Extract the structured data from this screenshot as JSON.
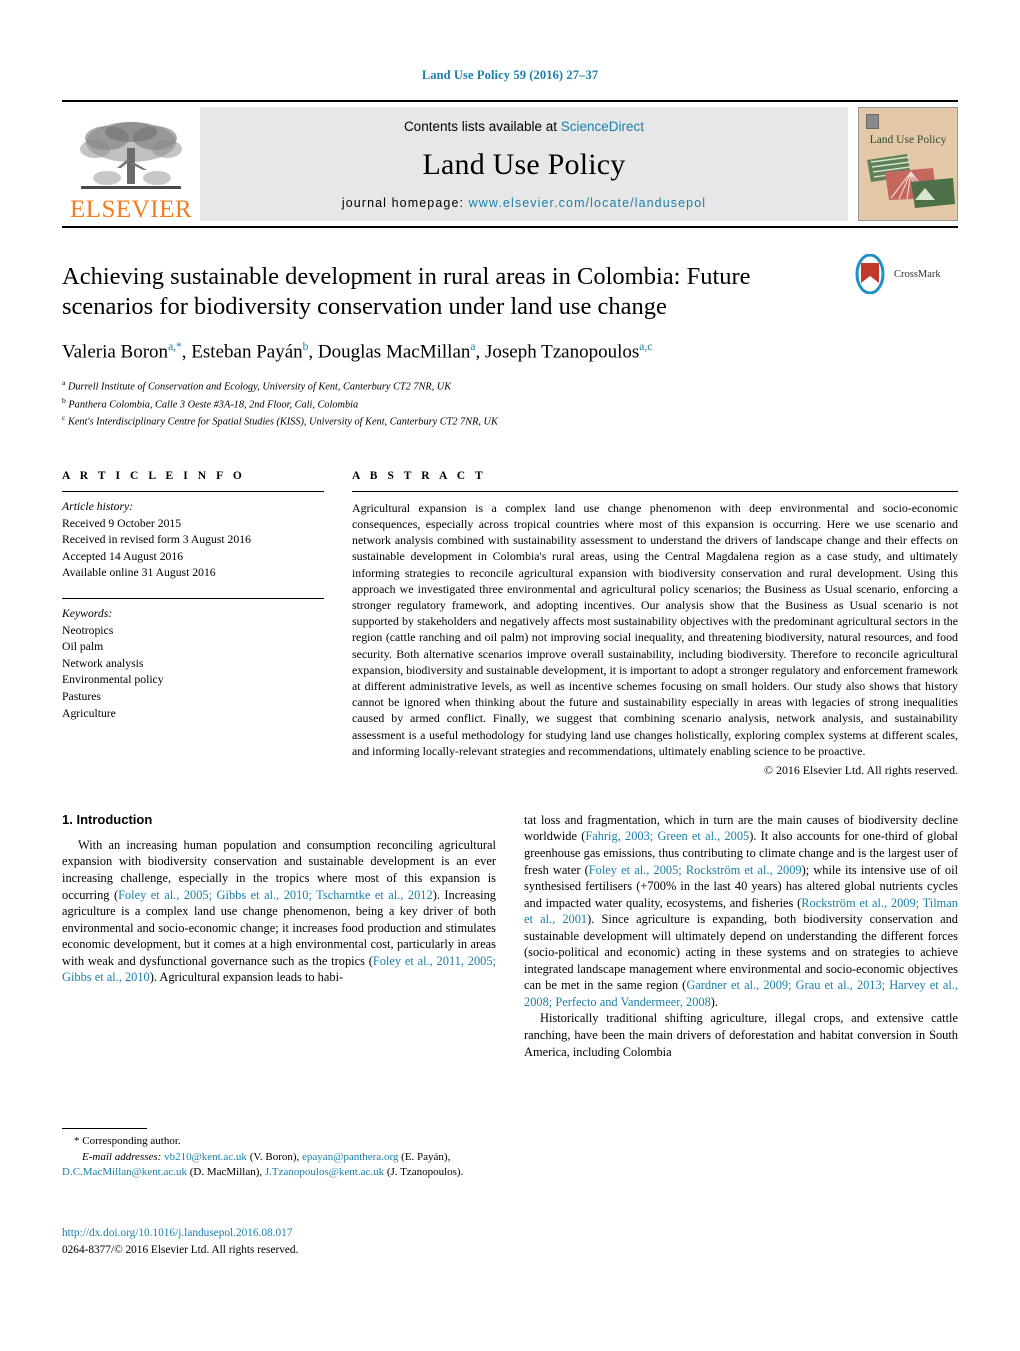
{
  "running_head": "Land Use Policy 59 (2016) 27–37",
  "masthead": {
    "publisher_word": "ELSEVIER",
    "contents_prefix": "Contents lists available at ",
    "contents_link": "ScienceDirect",
    "journal_name": "Land Use Policy",
    "homepage_prefix": "journal homepage: ",
    "homepage_url": "www.elsevier.com/locate/landusepol",
    "cover_title": "Land Use Policy"
  },
  "article": {
    "title": "Achieving sustainable development in rural areas in Colombia: Future scenarios for biodiversity conservation under land use change",
    "crossmark_label": "CrossMark",
    "authors": [
      {
        "name": "Valeria Boron",
        "sup": "a,*"
      },
      {
        "name": "Esteban Payán",
        "sup": "b"
      },
      {
        "name": "Douglas MacMillan",
        "sup": "a"
      },
      {
        "name": "Joseph Tzanopoulos",
        "sup": "a,c"
      }
    ],
    "authors_line": "Valeria Boron, Esteban Payán, Douglas MacMillan, Joseph Tzanopoulos",
    "affiliations": [
      {
        "mark": "a",
        "text": "Durrell Institute of Conservation and Ecology, University of Kent, Canterbury CT2 7NR, UK"
      },
      {
        "mark": "b",
        "text": "Panthera Colombia, Calle 3 Oeste #3A-18, 2nd Floor, Cali, Colombia"
      },
      {
        "mark": "c",
        "text": "Kent's Interdisciplinary Centre for Spatial Studies (KISS), University of Kent, Canterbury CT2 7NR, UK"
      }
    ]
  },
  "article_info": {
    "heading": "A R T I C L E   I N F O",
    "history_label": "Article history:",
    "history": [
      "Received 9 October 2015",
      "Received in revised form 3 August 2016",
      "Accepted 14 August 2016",
      "Available online 31 August 2016"
    ],
    "keywords_label": "Keywords:",
    "keywords": [
      "Neotropics",
      "Oil palm",
      "Network analysis",
      "Environmental policy",
      "Pastures",
      "Agriculture"
    ]
  },
  "abstract": {
    "heading": "A B S T R A C T",
    "text": "Agricultural expansion is a complex land use change phenomenon with deep environmental and socio-economic consequences, especially across tropical countries where most of this expansion is occurring. Here we use scenario and network analysis combined with sustainability assessment to understand the drivers of landscape change and their effects on sustainable development in Colombia's rural areas, using the Central Magdalena region as a case study, and ultimately informing strategies to reconcile agricultural expansion with biodiversity conservation and rural development. Using this approach we investigated three environmental and agricultural policy scenarios; the Business as Usual scenario, enforcing a stronger regulatory framework, and adopting incentives. Our analysis show that the Business as Usual scenario is not supported by stakeholders and negatively affects most sustainability objectives with the predominant agricultural sectors in the region (cattle ranching and oil palm) not improving social inequality, and threatening biodiversity, natural resources, and food security. Both alternative scenarios improve overall sustainability, including biodiversity. Therefore to reconcile agricultural expansion, biodiversity and sustainable development, it is important to adopt a stronger regulatory and enforcement framework at different administrative levels, as well as incentive schemes focusing on small holders. Our study also shows that history cannot be ignored when thinking about the future and sustainability especially in areas with legacies of strong inequalities caused by armed conflict. Finally, we suggest that combining scenario analysis, network analysis, and sustainability assessment is a useful methodology for studying land use changes holistically, exploring complex systems at different scales, and informing locally-relevant strategies and recommendations, ultimately enabling science to be proactive.",
    "copyright": "© 2016 Elsevier Ltd. All rights reserved."
  },
  "body": {
    "section_heading": "1. Introduction",
    "left_paragraph_1_a": "With an increasing human population and consumption reconciling agricultural expansion with biodiversity conservation and sustainable development is an ever increasing challenge, especially in the tropics where most of this expansion is occurring (",
    "left_cite_1": "Foley et al., 2005; Gibbs et al., 2010; Tscharntke et al., 2012",
    "left_paragraph_1_b": "). Increasing agriculture is a complex land use change phenomenon, being a key driver of both environmental and socio-economic change; it increases food production and stimulates economic development, but it comes at a high environmental cost, particularly in areas with weak and dysfunctional governance such as the tropics (",
    "left_cite_2": "Foley et al., 2011, 2005; Gibbs et al., 2010",
    "left_paragraph_1_c": "). Agricultural expansion leads to habi-",
    "right_paragraph_1_a": "tat loss and fragmentation, which in turn are the main causes of biodiversity decline worldwide (",
    "right_cite_1": "Fahrig, 2003; Green et al., 2005",
    "right_paragraph_1_b": "). It also accounts for one-third of global greenhouse gas emissions, thus contributing to climate change and is the largest user of fresh water (",
    "right_cite_2": "Foley et al., 2005; Rockström et al., 2009",
    "right_paragraph_1_c": "); while its intensive use of oil synthesised fertilisers (+700% in the last 40 years) has altered global nutrients cycles and impacted water quality, ecosystems, and fisheries (",
    "right_cite_3": "Rockström et al., 2009; Tilman et al., 2001",
    "right_paragraph_1_d": "). Since agriculture is expanding, both biodiversity conservation and sustainable development will ultimately depend on understanding the different forces (socio-political and economic) acting in these systems and on strategies to achieve integrated landscape management where environmental and socio-economic objectives can be met in the same region (",
    "right_cite_4": "Gardner et al., 2009; Grau et al., 2013; Harvey et al., 2008; Perfecto and Vandermeer, 2008",
    "right_paragraph_1_e": ").",
    "right_paragraph_2": "Historically traditional shifting agriculture, illegal crops, and extensive cattle ranching, have been the main drivers of deforestation and habitat conversion in South America, including Colombia"
  },
  "footnote": {
    "corresponding": "* Corresponding author.",
    "emails_label": "E-mail addresses:",
    "email_1": "vb210@kent.ac.uk",
    "email_1_owner": " (V. Boron), ",
    "email_2": "epayan@panthera.org",
    "email_2_owner": " (E. Payán), ",
    "email_3": "D.C.MacMillan@kent.ac.uk",
    "email_3_owner": " (D. MacMillan), ",
    "email_4": "J.Tzanopoulos@kent.ac.uk",
    "email_4_owner": " (J. Tzanopoulos)."
  },
  "doi": {
    "url": "http://dx.doi.org/10.1016/j.landusepol.2016.08.017",
    "issn_line": "0264-8377/© 2016 Elsevier Ltd. All rights reserved."
  },
  "colors": {
    "link": "#1a7fa8",
    "elsevier_orange": "#F47B20",
    "band_gray": "#e7e7e7",
    "cover_tan": "#e3c9a8"
  }
}
